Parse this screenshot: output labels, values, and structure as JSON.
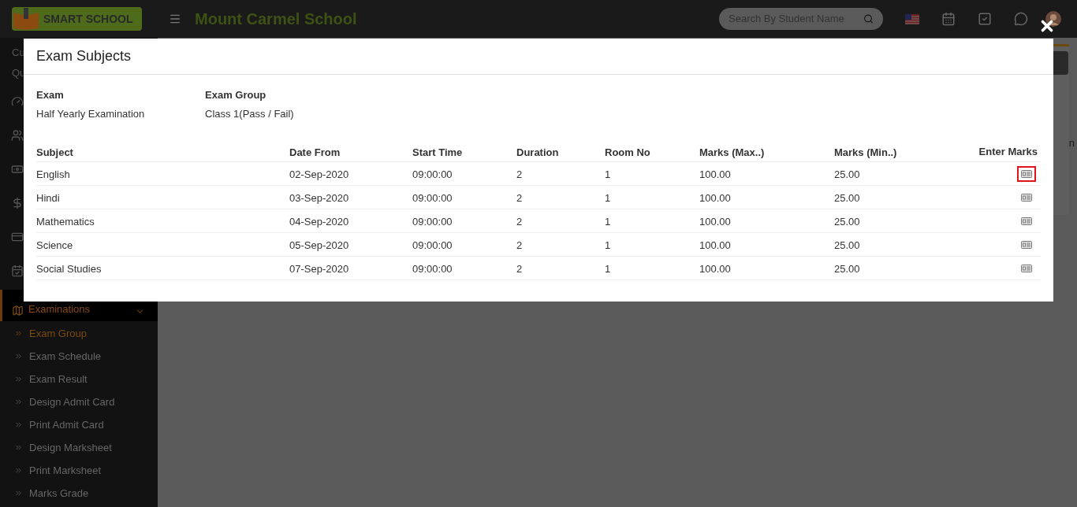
{
  "header": {
    "logo": "SMART SCHOOL",
    "school_name": "Mount Carmel School",
    "search": {
      "placeholder": "Search By Student Name"
    }
  },
  "sidebar": {
    "partial_texts": [
      "Cu",
      "Qu"
    ],
    "section": {
      "label": "Examinations",
      "expanded": true
    },
    "items": [
      {
        "label": "Exam Group",
        "selected": true
      },
      {
        "label": "Exam Schedule",
        "selected": false
      },
      {
        "label": "Exam Result",
        "selected": false
      },
      {
        "label": "Design Admit Card",
        "selected": false
      },
      {
        "label": "Print Admit Card",
        "selected": false
      },
      {
        "label": "Design Marksheet",
        "selected": false
      },
      {
        "label": "Print Marksheet",
        "selected": false
      },
      {
        "label": "Marks Grade",
        "selected": false
      }
    ]
  },
  "background_panel": {
    "partial_text": "n"
  },
  "modal": {
    "title": "Exam Subjects",
    "info": [
      {
        "label": "Exam",
        "value": "Half Yearly Examination"
      },
      {
        "label": "Exam Group",
        "value": "Class 1(Pass / Fail)"
      }
    ],
    "columns": [
      "Subject",
      "Date From",
      "Start Time",
      "Duration",
      "Room No",
      "Marks (Max..)",
      "Marks (Min..)",
      "Enter Marks"
    ],
    "rows": [
      {
        "cells": [
          "English",
          "02-Sep-2020",
          "09:00:00",
          "2",
          "1",
          "100.00",
          "25.00"
        ],
        "highlighted": true
      },
      {
        "cells": [
          "Hindi",
          "03-Sep-2020",
          "09:00:00",
          "2",
          "1",
          "100.00",
          "25.00"
        ],
        "highlighted": false
      },
      {
        "cells": [
          "Mathematics",
          "04-Sep-2020",
          "09:00:00",
          "2",
          "1",
          "100.00",
          "25.00"
        ],
        "highlighted": false
      },
      {
        "cells": [
          "Science",
          "05-Sep-2020",
          "09:00:00",
          "2",
          "1",
          "100.00",
          "25.00"
        ],
        "highlighted": false
      },
      {
        "cells": [
          "Social Studies",
          "07-Sep-2020",
          "09:00:00",
          "2",
          "1",
          "100.00",
          "25.00"
        ],
        "highlighted": false
      }
    ]
  }
}
